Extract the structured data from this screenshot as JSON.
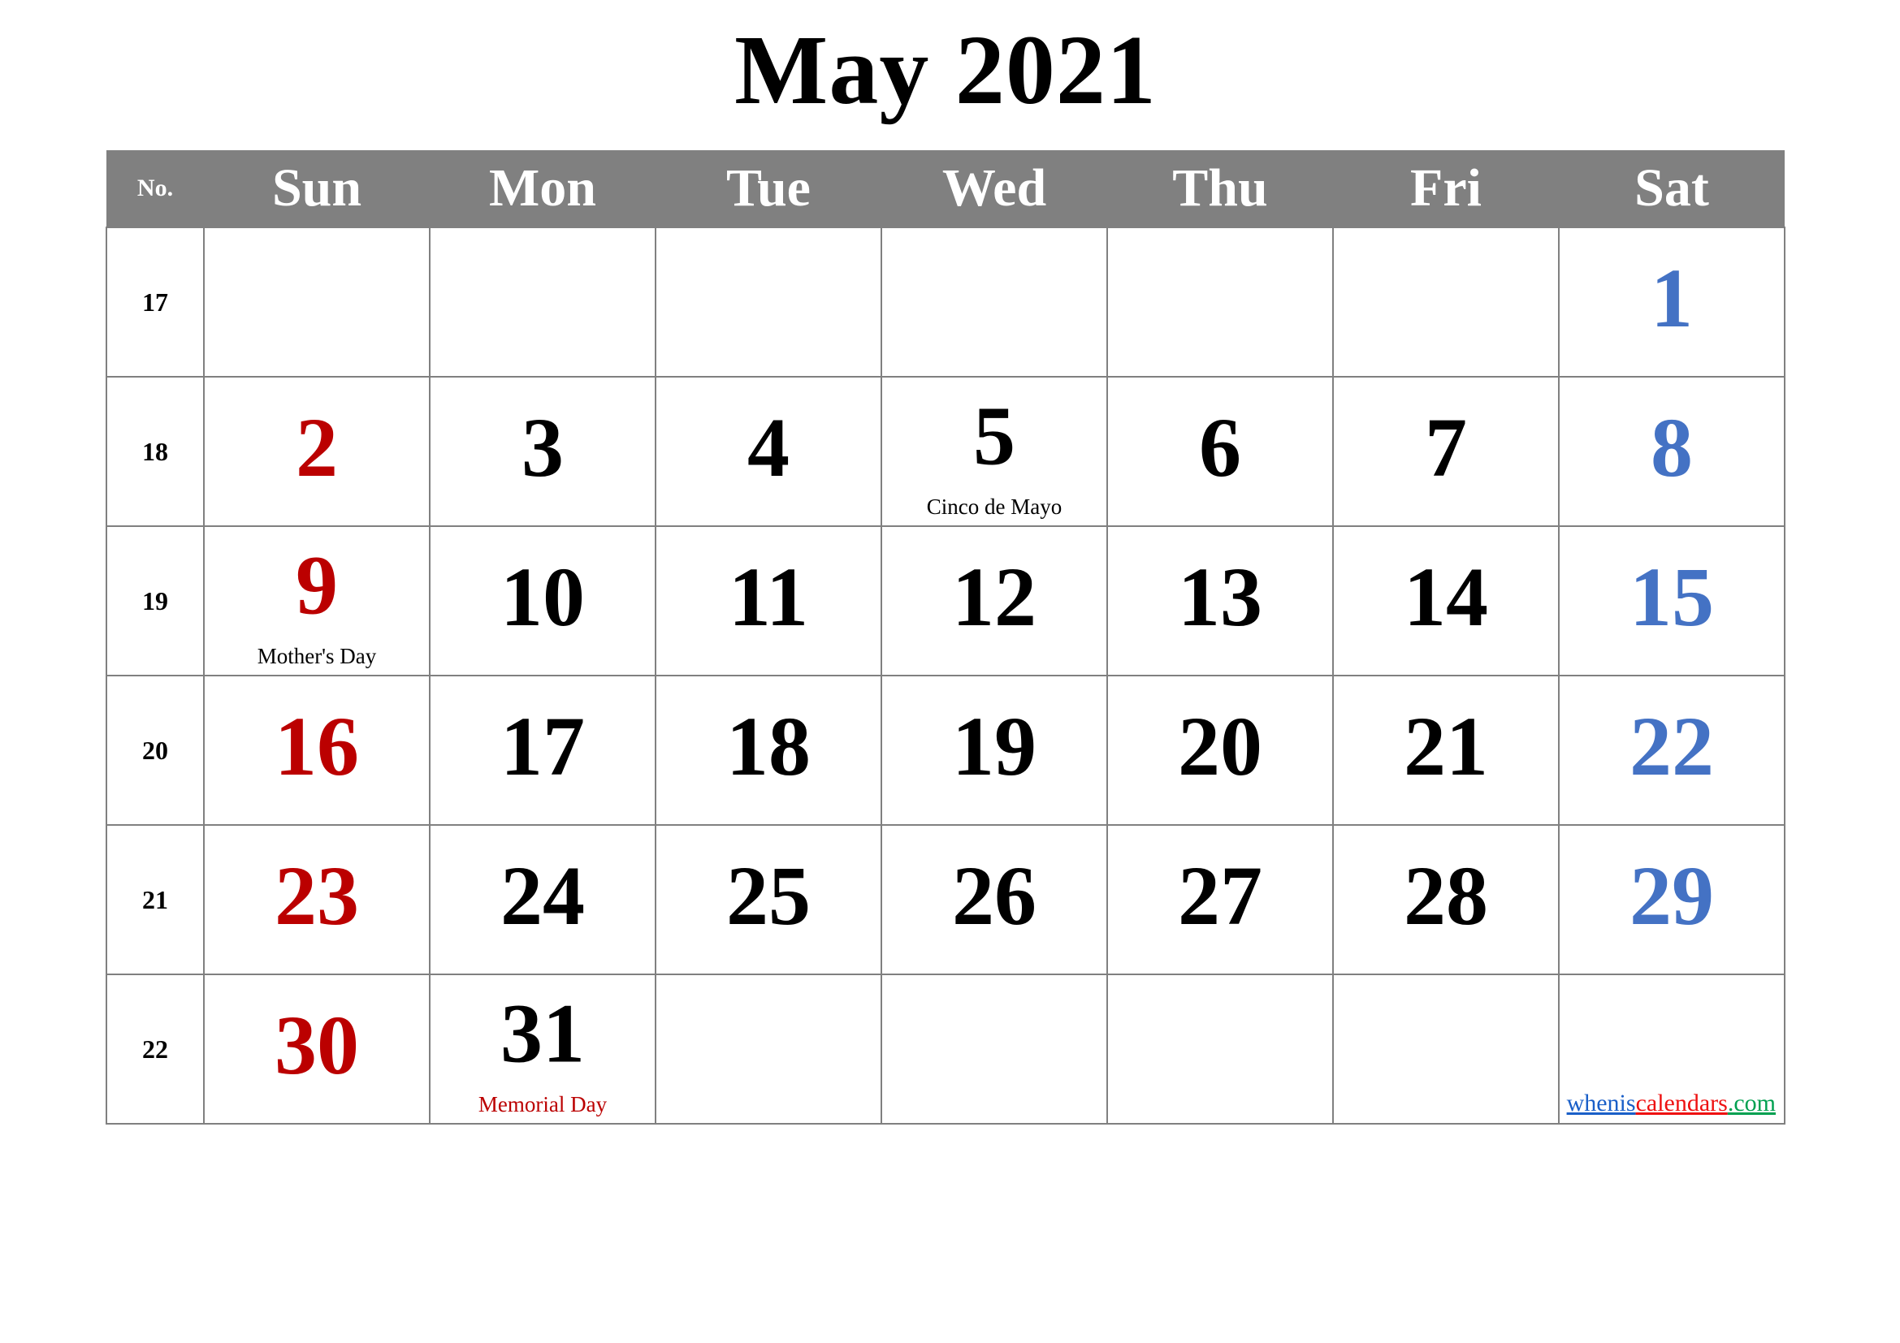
{
  "title": "May 2021",
  "header": {
    "no_label": "No.",
    "days": [
      "Sun",
      "Mon",
      "Tue",
      "Wed",
      "Thu",
      "Fri",
      "Sat"
    ]
  },
  "colors": {
    "header_background": "#808080",
    "header_text": "#ffffff",
    "grid_border": "#808080",
    "sunday": "#BB0000",
    "saturday": "#4472C4",
    "weekday": "#000000",
    "watermark_blue": "#1a5fc8",
    "watermark_red": "#ee1111",
    "watermark_green": "#00a050"
  },
  "weeks": [
    {
      "number": "17",
      "days": [
        {
          "num": "",
          "note": ""
        },
        {
          "num": "",
          "note": ""
        },
        {
          "num": "",
          "note": ""
        },
        {
          "num": "",
          "note": ""
        },
        {
          "num": "",
          "note": ""
        },
        {
          "num": "",
          "note": ""
        },
        {
          "num": "1",
          "note": ""
        }
      ]
    },
    {
      "number": "18",
      "days": [
        {
          "num": "2",
          "note": ""
        },
        {
          "num": "3",
          "note": ""
        },
        {
          "num": "4",
          "note": ""
        },
        {
          "num": "5",
          "note": "Cinco de Mayo"
        },
        {
          "num": "6",
          "note": ""
        },
        {
          "num": "7",
          "note": ""
        },
        {
          "num": "8",
          "note": ""
        }
      ]
    },
    {
      "number": "19",
      "days": [
        {
          "num": "9",
          "note": "Mother's Day"
        },
        {
          "num": "10",
          "note": ""
        },
        {
          "num": "11",
          "note": ""
        },
        {
          "num": "12",
          "note": ""
        },
        {
          "num": "13",
          "note": ""
        },
        {
          "num": "14",
          "note": ""
        },
        {
          "num": "15",
          "note": ""
        }
      ]
    },
    {
      "number": "20",
      "days": [
        {
          "num": "16",
          "note": ""
        },
        {
          "num": "17",
          "note": ""
        },
        {
          "num": "18",
          "note": ""
        },
        {
          "num": "19",
          "note": ""
        },
        {
          "num": "20",
          "note": ""
        },
        {
          "num": "21",
          "note": ""
        },
        {
          "num": "22",
          "note": ""
        }
      ]
    },
    {
      "number": "21",
      "days": [
        {
          "num": "23",
          "note": ""
        },
        {
          "num": "24",
          "note": ""
        },
        {
          "num": "25",
          "note": ""
        },
        {
          "num": "26",
          "note": ""
        },
        {
          "num": "27",
          "note": ""
        },
        {
          "num": "28",
          "note": ""
        },
        {
          "num": "29",
          "note": ""
        }
      ]
    },
    {
      "number": "22",
      "days": [
        {
          "num": "30",
          "note": ""
        },
        {
          "num": "31",
          "note": "Memorial Day"
        },
        {
          "num": "",
          "note": ""
        },
        {
          "num": "",
          "note": ""
        },
        {
          "num": "",
          "note": ""
        },
        {
          "num": "",
          "note": ""
        },
        {
          "num": "",
          "note": ""
        }
      ]
    }
  ],
  "watermark": {
    "part1": "whenis",
    "part2": "calendars",
    "part3": ".com"
  }
}
